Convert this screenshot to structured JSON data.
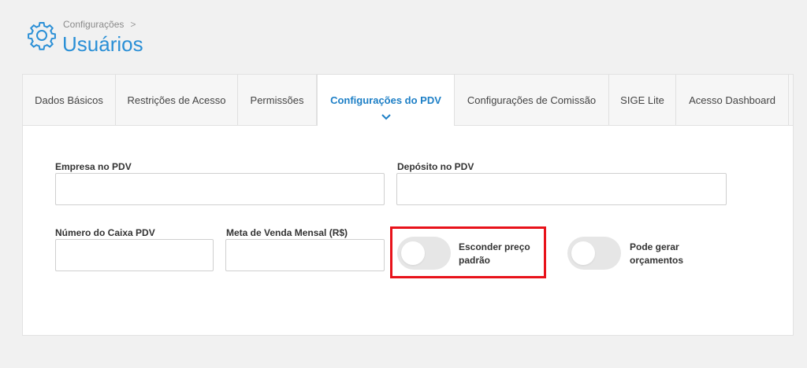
{
  "header": {
    "breadcrumb": "Configurações",
    "breadcrumb_sep": ">",
    "title": "Usuários",
    "icon": "gear-icon"
  },
  "tabs": [
    {
      "label": "Dados Básicos",
      "active": false
    },
    {
      "label": "Restrições de Acesso",
      "active": false
    },
    {
      "label": "Permissões",
      "active": false
    },
    {
      "label": "Configurações do PDV",
      "active": true
    },
    {
      "label": "Configurações de Comissão",
      "active": false
    },
    {
      "label": "SIGE Lite",
      "active": false
    },
    {
      "label": "Acesso Dashboard",
      "active": false
    }
  ],
  "form": {
    "empresa": {
      "label": "Empresa no PDV",
      "value": ""
    },
    "deposito": {
      "label": "Depósito no PDV",
      "value": ""
    },
    "caixa": {
      "label": "Número do Caixa PDV",
      "value": ""
    },
    "meta": {
      "label": "Meta de Venda Mensal (R$)",
      "value": ""
    },
    "esconder_preco": {
      "label": "Esconder preço padrão",
      "checked": false
    },
    "orcamentos": {
      "label": "Pode gerar orçamentos",
      "checked": false
    }
  },
  "colors": {
    "accent": "#2a8fd6",
    "active_tab": "#1d7fc6",
    "highlight": "#e8121a",
    "toggle_off": "#e6e6e6"
  }
}
